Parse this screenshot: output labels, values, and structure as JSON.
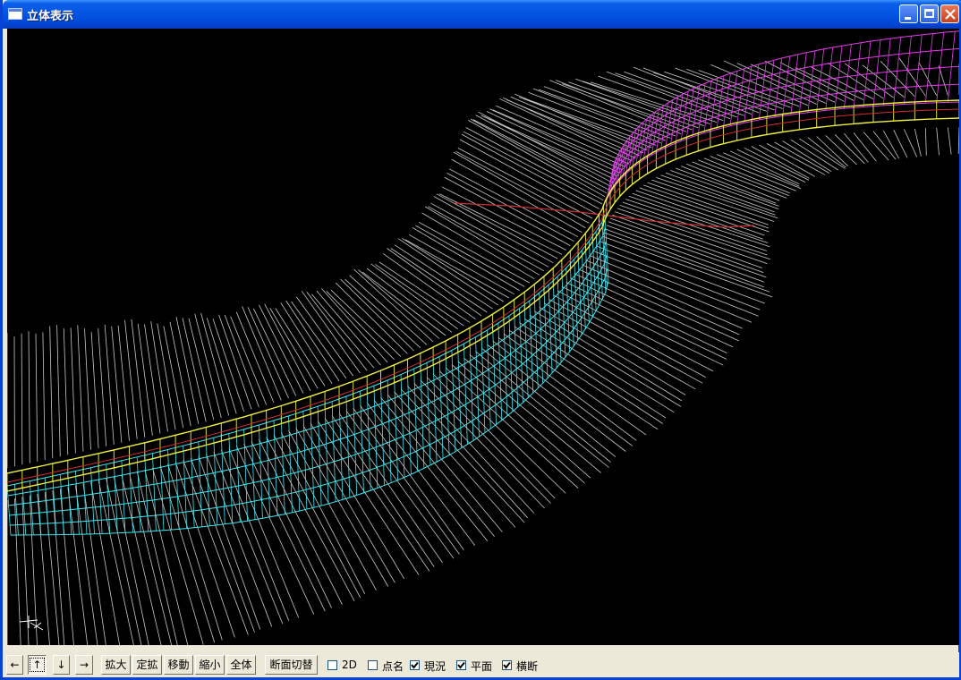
{
  "window": {
    "title": "立体表示"
  },
  "toolbar": {
    "nav_left": "←",
    "nav_up": "↑",
    "nav_down": "↓",
    "nav_right": "→",
    "zoom_in": "拡大",
    "fixed_zoom": "定拡",
    "move": "移動",
    "zoom_out": "縮小",
    "fit_all": "全体",
    "section_switch": "断面切替"
  },
  "options": [
    {
      "label": "2D",
      "checked": false
    },
    {
      "label": "点名",
      "checked": false
    },
    {
      "label": "現況",
      "checked": true
    },
    {
      "label": "平面",
      "checked": true
    },
    {
      "label": "横断",
      "checked": true
    }
  ],
  "colors": {
    "terrain": "#c8c8c8",
    "cross_section": "#3ee8f2",
    "road_plan": "#f0f040",
    "upper_slope": "#e040e8",
    "centerline": "#d03030"
  }
}
